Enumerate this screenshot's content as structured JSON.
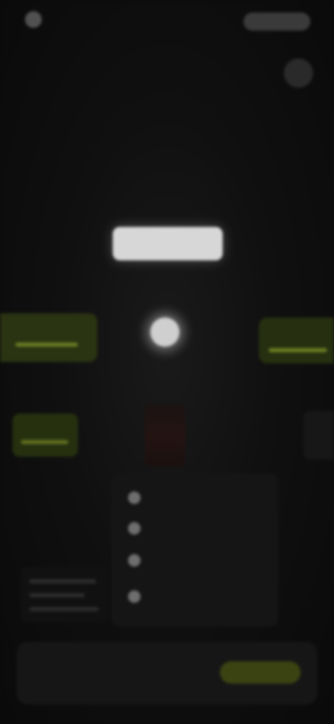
{
  "header": {
    "brand": "",
    "action_label": "",
    "meta": ""
  },
  "hero": {
    "headline": "",
    "headline_accent": "",
    "subline": "",
    "subline2": ""
  },
  "center": {
    "pill_label": "",
    "orb_caption": ""
  },
  "options": {
    "left_label": "",
    "right_label": "",
    "small_card_label": ""
  },
  "checklist": {
    "items": [
      "",
      "",
      "",
      ""
    ],
    "sub": ""
  },
  "bottom": {
    "left_label": "",
    "cta_label": ""
  },
  "colors": {
    "background": "#0c0c0c",
    "accent_green": "#6a7a24",
    "pill": "#d7d7d7"
  },
  "icons": {
    "logo": "logo-icon",
    "check": "check-circle-icon",
    "orb": "glow-dot-icon"
  }
}
